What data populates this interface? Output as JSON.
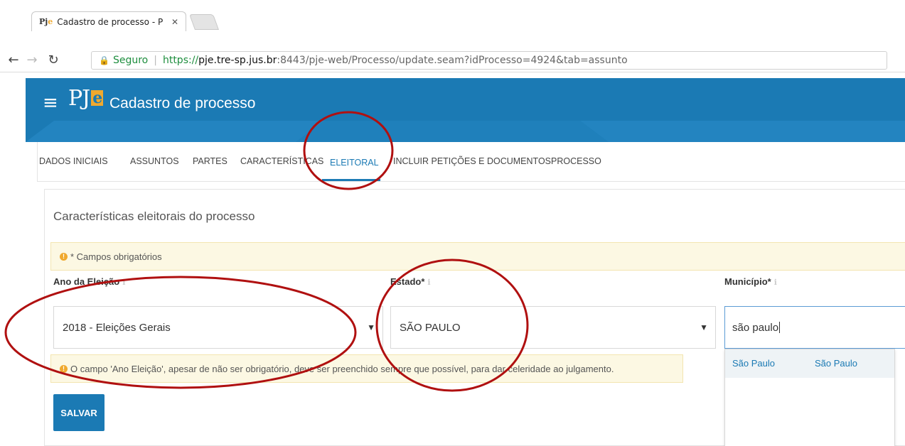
{
  "browser": {
    "tab_title": "Cadastro de processo - P",
    "tab_favicon": "PJe",
    "tab_close": "✕",
    "back_icon": "arrow-left-icon",
    "forward_icon": "arrow-right-icon",
    "reload_icon": "reload-icon",
    "secure_label": "Seguro",
    "url_scheme": "https://",
    "url_host": "pje.tre-sp.jus.br",
    "url_rest": ":8443/pje-web/Processo/update.seam?idProcesso=4924&tab=assunto"
  },
  "header": {
    "logo_text": "PJ",
    "logo_accent": "e",
    "title": "Cadastro de processo",
    "color": "#1b7ab4",
    "accent_color": "#f0a92e"
  },
  "tabs": [
    {
      "label": "DADOS INICIAIS"
    },
    {
      "label": "ASSUNTOS"
    },
    {
      "label": "PARTES"
    },
    {
      "label": "CARACTERÍSTICAS"
    },
    {
      "label": "ELEITORAL",
      "active": true
    },
    {
      "label": "INCLUIR PETIÇÕES E DOCUMENTOS"
    },
    {
      "label": "PROCESSO"
    }
  ],
  "main": {
    "section_title": "Características eleitorais do processo",
    "required_notice": "* Campos obrigatórios",
    "fields": {
      "ano_label": "Ano da Eleição",
      "ano_value": "2018 - Eleições Gerais",
      "estado_label": "Estado*",
      "estado_value": "SÃO PAULO",
      "municipio_label": "Município*",
      "municipio_value": "são paulo"
    },
    "autocomplete": {
      "col1": "São Paulo",
      "col2": "São Paulo"
    },
    "info_notice": "O campo 'Ano Eleição', apesar de não ser obrigatório, deve ser preenchido sempre que possível, para dar celeridade ao julgamento.",
    "save_label": "SALVAR"
  }
}
